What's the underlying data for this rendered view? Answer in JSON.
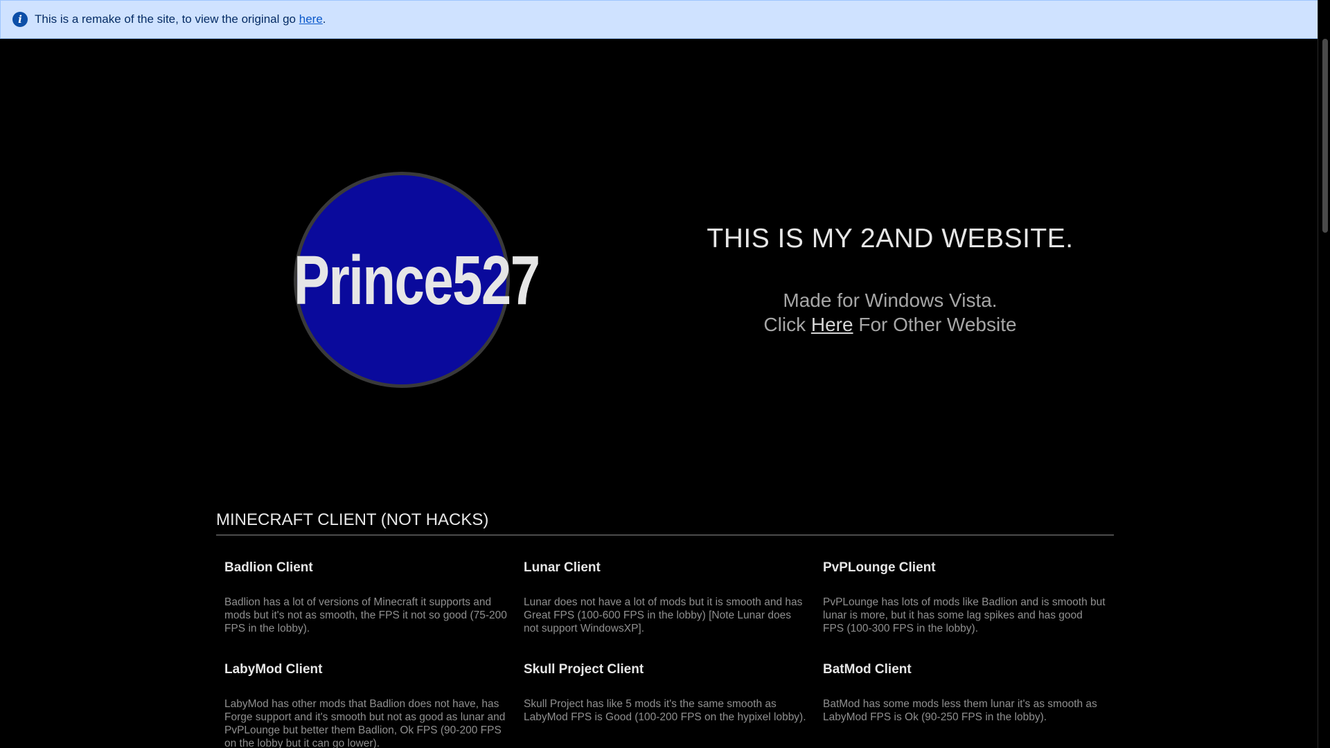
{
  "banner": {
    "icon": "info-icon",
    "text": "This is a remake of the site, to view the original go ",
    "link_label": "here",
    "suffix": "."
  },
  "logo": {
    "text": "Prince527",
    "circle_color": "#0a0a9c"
  },
  "hero": {
    "title": "THIS IS MY 2AND WEBSITE.",
    "line1": "Made for Windows Vista.",
    "line2_prefix": "Click ",
    "line2_link": "Here",
    "line2_suffix": " For Other Website"
  },
  "section": {
    "title": "MINECRAFT CLIENT (NOT HACKS)",
    "clients": [
      {
        "name": "Badlion Client",
        "description": "Badlion has a lot of versions of Minecraft it supports and mods but it's not as smooth, the FPS it not so good (75-200 FPS in the lobby)."
      },
      {
        "name": "Lunar Client",
        "description": "Lunar does not have a lot of mods but it is smooth and has Great FPS (100-600 FPS in the lobby) [Note Lunar does not support WindowsXP]."
      },
      {
        "name": "PvPLounge Client",
        "description": "PvPLounge has lots of mods like Badlion and is smooth but lunar is more, but it has some lag spikes and has good FPS (100-300 FPS in the lobby)."
      },
      {
        "name": "LabyMod Client",
        "description": "LabyMod has other mods that Badlion does not have, has Forge support and it's smooth but not as good as lunar and PvPLounge but better them Badlion, Ok FPS (90-200 FPS on the lobby but it can go lower)."
      },
      {
        "name": "Skull Project Client",
        "description": "Skull Project has like 5 mods it's the same smooth as LabyMod FPS is Good (100-200 FPS on the hypixel lobby)."
      },
      {
        "name": "BatMod Client",
        "description": "BatMod has some mods less them lunar it's as smooth as LabyMod FPS is Ok (90-250 FPS in the lobby)."
      }
    ]
  },
  "colors": {
    "background": "#000000",
    "banner_bg": "#cfe2ff",
    "banner_text": "#052c65",
    "link": "#0a58ca"
  }
}
